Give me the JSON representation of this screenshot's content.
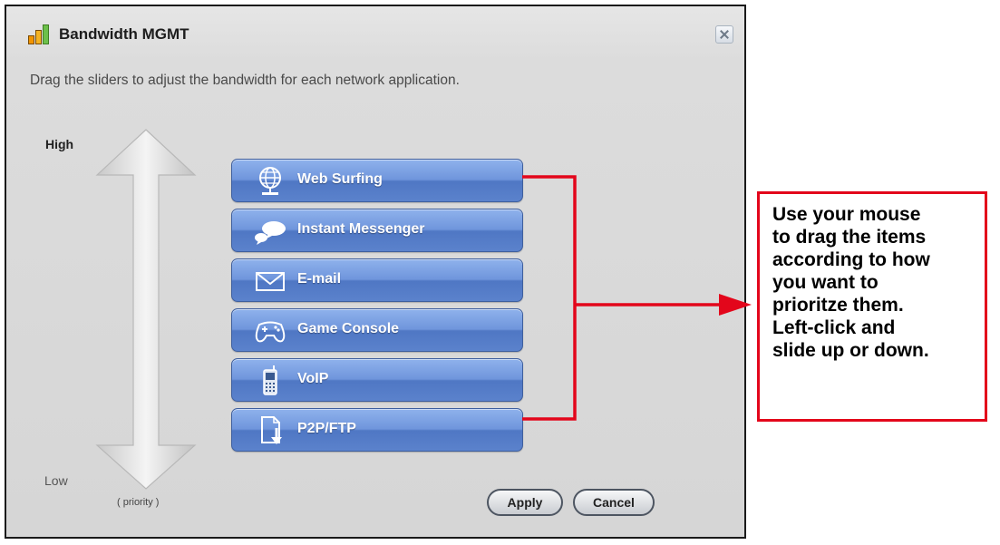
{
  "window": {
    "title": "Bandwidth MGMT",
    "instruction": "Drag the sliders to adjust the bandwidth for each network application."
  },
  "priority": {
    "high": "High",
    "low": "Low",
    "caption": "( priority )"
  },
  "apps": [
    {
      "label": "Web Surfing",
      "icon": "globe-icon"
    },
    {
      "label": "Instant Messenger",
      "icon": "chat-bubbles-icon"
    },
    {
      "label": "E-mail",
      "icon": "envelope-icon"
    },
    {
      "label": "Game Console",
      "icon": "gamepad-icon"
    },
    {
      "label": "VoIP",
      "icon": "phone-icon"
    },
    {
      "label": "P2P/FTP",
      "icon": "file-download-icon"
    }
  ],
  "actions": {
    "apply": "Apply",
    "cancel": "Cancel"
  },
  "callout": {
    "lines": [
      "Use your mouse",
      "to drag the items",
      "according to how",
      "you want to",
      "prioritze them.",
      "Left-click and",
      "slide up or down."
    ]
  },
  "colors": {
    "button_blue": "#5b82cc",
    "callout_red": "#e3061b",
    "logo_orange": "#f29400",
    "logo_green": "#6cc04a"
  }
}
